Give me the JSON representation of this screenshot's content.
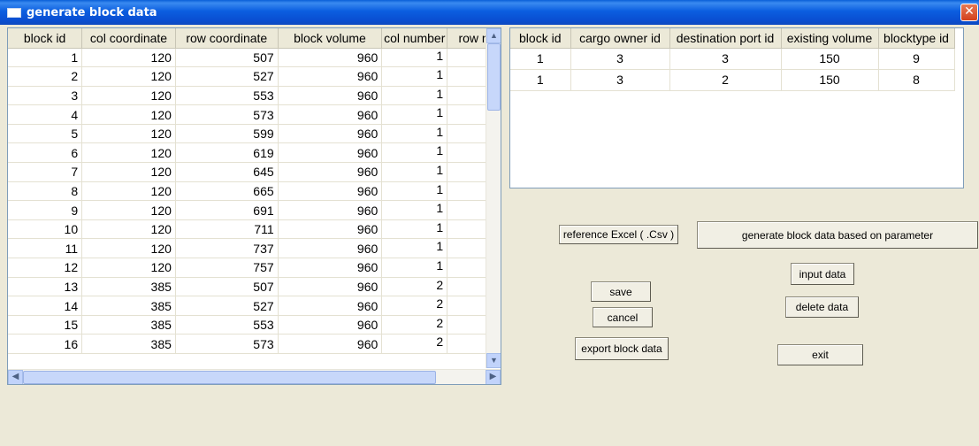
{
  "window": {
    "title": "generate block data",
    "close_glyph": "✕"
  },
  "left_grid": {
    "columns": [
      "block id",
      "col coordinate",
      "row coordinate",
      "block volume",
      "col number",
      "row n"
    ],
    "rows": [
      [
        "1",
        "120",
        "507",
        "960",
        "1",
        ""
      ],
      [
        "2",
        "120",
        "527",
        "960",
        "1",
        ""
      ],
      [
        "3",
        "120",
        "553",
        "960",
        "1",
        ""
      ],
      [
        "4",
        "120",
        "573",
        "960",
        "1",
        ""
      ],
      [
        "5",
        "120",
        "599",
        "960",
        "1",
        ""
      ],
      [
        "6",
        "120",
        "619",
        "960",
        "1",
        ""
      ],
      [
        "7",
        "120",
        "645",
        "960",
        "1",
        ""
      ],
      [
        "8",
        "120",
        "665",
        "960",
        "1",
        ""
      ],
      [
        "9",
        "120",
        "691",
        "960",
        "1",
        ""
      ],
      [
        "10",
        "120",
        "711",
        "960",
        "1",
        ""
      ],
      [
        "11",
        "120",
        "737",
        "960",
        "1",
        ""
      ],
      [
        "12",
        "120",
        "757",
        "960",
        "1",
        ""
      ],
      [
        "13",
        "385",
        "507",
        "960",
        "2",
        ""
      ],
      [
        "14",
        "385",
        "527",
        "960",
        "2",
        ""
      ],
      [
        "15",
        "385",
        "553",
        "960",
        "2",
        ""
      ],
      [
        "16",
        "385",
        "573",
        "960",
        "2",
        ""
      ]
    ]
  },
  "right_grid": {
    "columns": [
      "block id",
      "cargo owner id",
      "destination port id",
      "existing volume",
      "blocktype id"
    ],
    "rows": [
      [
        "1",
        "3",
        "3",
        "150",
        "9"
      ],
      [
        "1",
        "3",
        "2",
        "150",
        "8"
      ]
    ]
  },
  "buttons": {
    "reference_excel": "reference Excel ( .Csv )",
    "generate": "generate block data based on parameter",
    "input_data": "input data",
    "save": "save",
    "delete_data": "delete data",
    "cancel": "cancel",
    "export": "export block data",
    "exit": "exit"
  },
  "scroll_glyphs": {
    "up": "▲",
    "down": "▼",
    "left": "◀",
    "right": "▶"
  }
}
